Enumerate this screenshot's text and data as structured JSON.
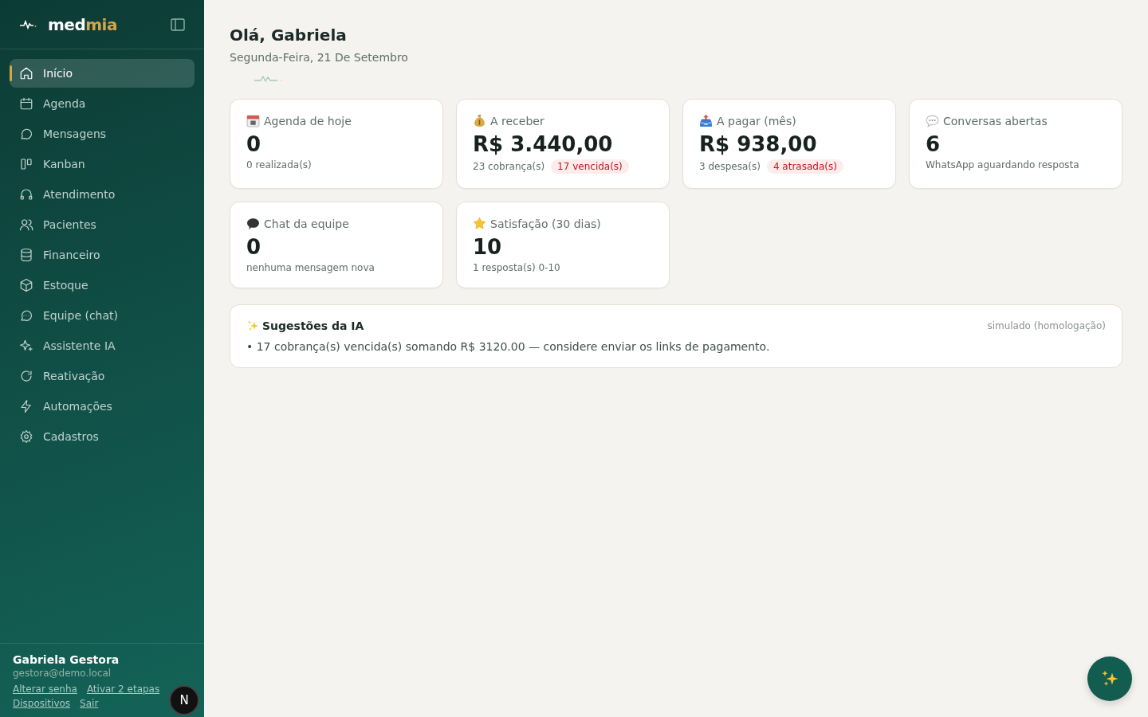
{
  "sidebar": {
    "brand": {
      "part_1": "med",
      "part_2": "mia"
    },
    "items": [
      {
        "label": "Início",
        "kind": "home",
        "selected": true
      },
      {
        "label": "Agenda",
        "kind": "calendar",
        "selected": false
      },
      {
        "label": "Mensagens",
        "kind": "chat",
        "selected": false
      },
      {
        "label": "Kanban",
        "kind": "kanban",
        "selected": false
      },
      {
        "label": "Atendimento",
        "kind": "headset",
        "selected": false
      },
      {
        "label": "Pacientes",
        "kind": "users",
        "selected": false
      },
      {
        "label": "Financeiro",
        "kind": "database",
        "selected": false
      },
      {
        "label": "Estoque",
        "kind": "box",
        "selected": false
      },
      {
        "label": "Equipe (chat)",
        "kind": "chatdots",
        "selected": false
      },
      {
        "label": "Assistente IA",
        "kind": "sparkle",
        "selected": false
      },
      {
        "label": "Reativação",
        "kind": "refresh",
        "selected": false
      },
      {
        "label": "Automações",
        "kind": "bolt",
        "selected": false
      },
      {
        "label": "Cadastros",
        "kind": "gear",
        "selected": false
      }
    ],
    "user": {
      "name": "Gabriela Gestora",
      "email": "gestora@demo.local",
      "links": [
        "Alterar senha",
        "Ativar 2 etapas",
        "Dispositivos",
        "Sair"
      ]
    }
  },
  "header": {
    "greeting": "Olá, Gabriela",
    "date": "Segunda-Feira, 21 De Setembro"
  },
  "cards": [
    {
      "kind": "calendar",
      "title": "Agenda de hoje",
      "value": "0",
      "note": "0 realizada(s)"
    },
    {
      "kind": "moneybag",
      "title": "A receber",
      "value": "R$ 3.440,00",
      "note": "23 cobrança(s)",
      "badge": "17 vencida(s)"
    },
    {
      "kind": "outbox",
      "title": "A pagar (mês)",
      "value": "R$ 938,00",
      "note": "3 despesa(s)",
      "badge": "4 atrasada(s)"
    },
    {
      "kind": "speech",
      "title": "Conversas abertas",
      "value": "6",
      "note": "WhatsApp aguardando resposta"
    },
    {
      "kind": "bubble",
      "title": "Chat da equipe",
      "value": "0",
      "note": "nenhuma mensagem nova"
    },
    {
      "kind": "star",
      "title": "Satisfação (30 dias)",
      "value": "10",
      "note": "1 resposta(s) 0-10"
    }
  ],
  "suggestions": {
    "title": "Sugestões da IA",
    "mode": "simulado (homologação)",
    "items": [
      "• 17 cobrança(s) vencida(s) somando R$ 3120.00 — considere enviar os links de pagamento."
    ]
  },
  "dev_badge": "N"
}
